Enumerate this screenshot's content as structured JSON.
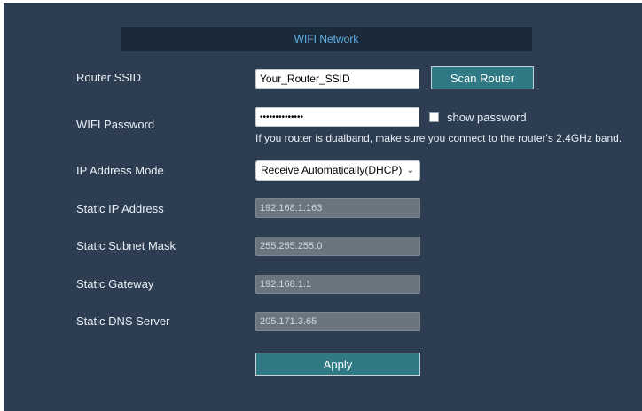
{
  "header": {
    "title": "WIFI Network"
  },
  "ssid": {
    "label": "Router SSID",
    "value": "Your_Router_SSID",
    "scan_button": "Scan Router"
  },
  "password": {
    "label": "WIFI Password",
    "value": "••••••••••••••",
    "show_label": "show password",
    "note": "If you router is dualband, make sure you connect to the router's 2.4GHz band."
  },
  "ip_mode": {
    "label": "IP Address Mode",
    "selected": "Receive Automatically(DHCP)"
  },
  "static_ip": {
    "label": "Static IP Address",
    "value": "192.168.1.163"
  },
  "subnet": {
    "label": "Static Subnet Mask",
    "value": "255.255.255.0"
  },
  "gateway": {
    "label": "Static Gateway",
    "value": "192.168.1.1"
  },
  "dns": {
    "label": "Static DNS Server",
    "value": "205.171.3.65"
  },
  "apply_button": "Apply",
  "colors": {
    "panel": "#2d3e52",
    "header_bg": "#1b2a3b",
    "header_text": "#5fb0e6",
    "button": "#2f7a84",
    "disabled_field": "#6a7580"
  }
}
